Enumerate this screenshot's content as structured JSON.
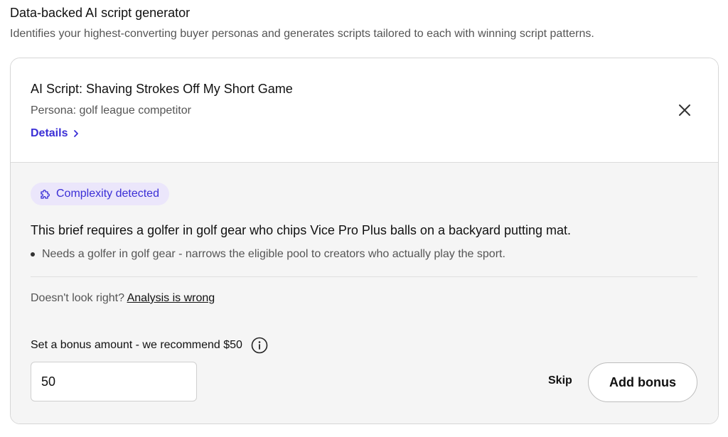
{
  "header": {
    "title": "Data-backed AI script generator",
    "subtitle": "Identifies your highest-converting buyer personas and generates scripts tailored to each with winning script patterns."
  },
  "script_card": {
    "title": "AI Script: Shaving Strokes Off My Short Game",
    "persona": "Persona: golf league competitor",
    "details_label": "Details",
    "close_icon": "close-icon"
  },
  "complexity": {
    "badge_label": "Complexity detected",
    "badge_icon": "puzzle-icon",
    "accent_color": "#3b2fd6",
    "badge_bg": "#ebe6fb",
    "brief": "This brief requires a golfer in golf gear who chips Vice Pro Plus balls on a backyard putting mat.",
    "bullets": [
      "Needs a golfer in golf gear - narrows the eligible pool to creators who actually play the sport."
    ],
    "feedback_prompt": "Doesn't look right?",
    "feedback_link": "Analysis is wrong"
  },
  "bonus": {
    "label": "Set a bonus amount - we recommend $50",
    "info_icon": "info-icon",
    "input_value": "50",
    "skip_label": "Skip",
    "add_label": "Add bonus"
  }
}
